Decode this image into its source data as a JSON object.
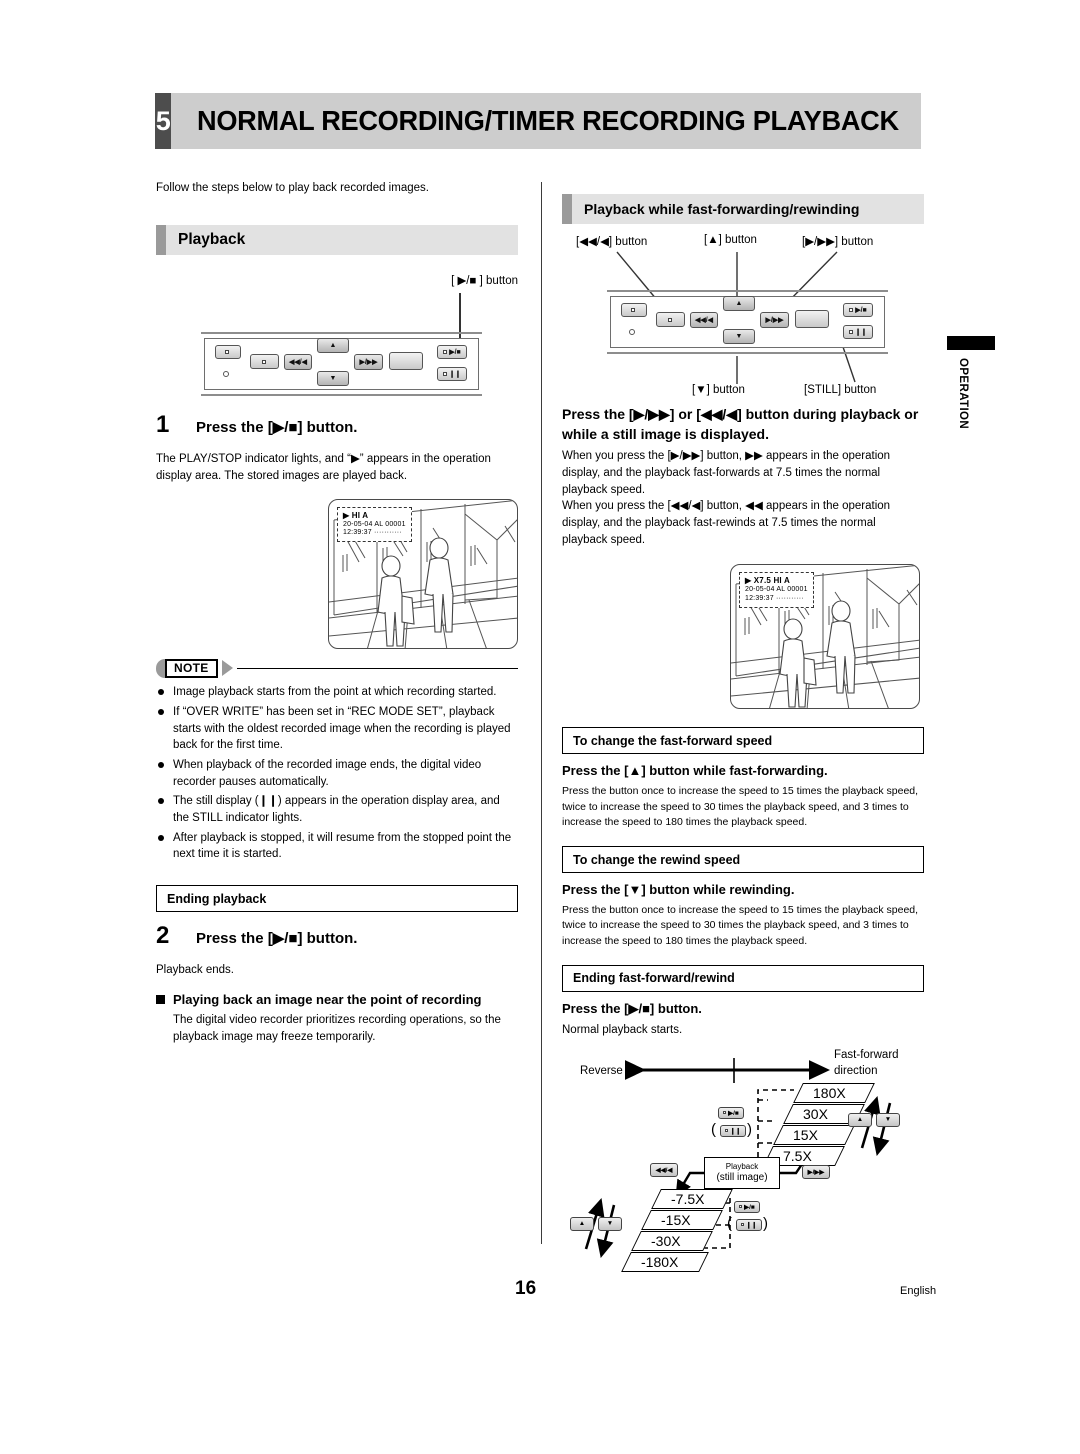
{
  "header": {
    "chapter_number": "5",
    "chapter_title": "NORMAL RECORDING/TIMER RECORDING PLAYBACK"
  },
  "side_tab": {
    "label": "OPERATION"
  },
  "footer": {
    "page_number": "16",
    "language": "English"
  },
  "left_column": {
    "intro": "Follow the steps below to play back recorded images.",
    "section_title": "Playback",
    "panel_callout": "[ ▶/■ ] button",
    "panel_buttons": {
      "rew": "◀◀/◀",
      "ff": "▶/▶▶",
      "up": "▲",
      "down": "▼",
      "play_stop": "▶/■",
      "still": "❙❙"
    },
    "step1": {
      "number": "1",
      "text": "Press the [▶/■] button."
    },
    "step1_body": "The PLAY/STOP indicator lights, and “▶” appears in the operation display area. The stored images are played back.",
    "screen_osd": {
      "line1": "▶        HI  A",
      "line2": "20-05-04  AL    00001",
      "line3": "12:39:37   ···········"
    },
    "note": {
      "label": "NOTE",
      "items": [
        "Image playback starts from the point at which recording started.",
        "If “OVER WRITE” has been set in “REC MODE SET”, playback starts with the oldest recorded image when the recording is played back for the first time.",
        "When playback of the recorded image ends, the digital video recorder pauses automatically.",
        "The still display (❙❙) appears in the operation display area, and the STILL indicator lights.",
        "After playback is stopped, it will resume from the stopped point the next time it is started."
      ]
    },
    "ending_playback_head": "Ending playback",
    "step2": {
      "number": "2",
      "text": "Press the [▶/■] button."
    },
    "step2_body": "Playback ends.",
    "near_point_head": "Playing back an image near the point of recording",
    "near_point_body": "The digital video recorder prioritizes recording operations, so the playback image may freeze temporarily."
  },
  "right_column": {
    "section_title": "Playback while fast-forwarding/rewinding",
    "callouts": {
      "rew": "[◀◀/◀] button",
      "up": "[▲] button",
      "ff": "[▶/▶▶] button",
      "down": "[▼] button",
      "still": "[STILL] button"
    },
    "panel_buttons": {
      "rew": "◀◀/◀",
      "ff": "▶/▶▶",
      "up": "▲",
      "down": "▼",
      "play_stop": "▶/■",
      "still": "❙❙"
    },
    "lead": "Press the [▶/▶▶] or [◀◀/◀] button during playback or while a still image is displayed.",
    "body1": "When you press the [▶/▶▶] button, ▶▶ appears in the operation display, and the playback fast-forwards at 7.5 times the normal playback speed.",
    "body2": "When you press the [◀◀/◀] button, ◀◀ appears in the operation display, and the playback fast-rewinds at 7.5 times the normal playback speed.",
    "screen_osd": {
      "line1": "▶  X7.5  HI  A",
      "line2": "20-05-04  AL    00001",
      "line3": "12:39:37   ···········"
    },
    "ff_speed_head": "To change the fast-forward speed",
    "ff_speed_lead": "Press the [▲] button while fast-forwarding.",
    "ff_speed_body": "Press the button once to increase the speed to 15 times the playback speed, twice to increase the speed to 30 times the playback speed, and 3 times to increase the speed to 180 times the playback speed.",
    "rew_speed_head": "To change the rewind speed",
    "rew_speed_lead": "Press the [▼] button while rewinding.",
    "rew_speed_body": "Press the button once to increase the speed to 15 times the playback speed, twice to increase the speed to 30 times the playback speed, and 3 times to increase the speed to 180 times the playback speed.",
    "ending_head": "Ending fast-forward/rewind",
    "ending_lead": "Press the [▶/■] button.",
    "ending_body": "Normal playback starts."
  },
  "speed_diagram": {
    "reverse_label": "Reverse",
    "forward_label_l1": "Fast-forward",
    "forward_label_l2": "direction",
    "still_box_l1": "Playback",
    "still_box_l2": "(still image)",
    "forward_speeds": [
      "180X",
      "30X",
      "15X",
      "7.5X"
    ],
    "reverse_speeds": [
      "-7.5X",
      "-15X",
      "-30X",
      "-180X"
    ],
    "keys": {
      "rew": "◀◀/◀",
      "ff": "▶/▶▶",
      "up": "▲",
      "down": "▼",
      "play_stop": "▶/■",
      "still": "❙❙"
    }
  }
}
